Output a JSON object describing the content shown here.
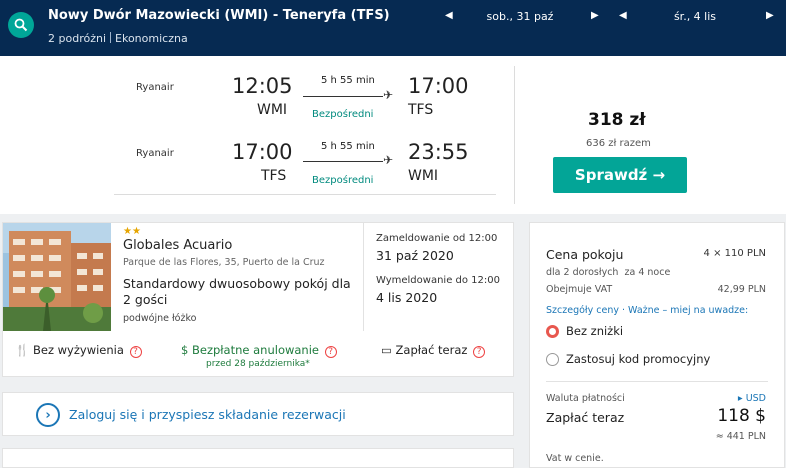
{
  "header": {
    "route": "Nowy Dwór Mazowiecki (WMI) - Teneryfa (TFS)",
    "passengers": "2 podróżni",
    "cabin": "Ekonomiczna",
    "depart_date": "sob., 31 paź",
    "return_date": "śr., 4 lis"
  },
  "flights": {
    "outbound": {
      "airline": "Ryanair",
      "dep_time": "12:05",
      "dep_code": "WMI",
      "duration": "5 h 55 min",
      "stops": "Bezpośredni",
      "arr_time": "17:00",
      "arr_code": "TFS"
    },
    "inbound": {
      "airline": "Ryanair",
      "dep_time": "17:00",
      "dep_code": "TFS",
      "duration": "5 h 55 min",
      "stops": "Bezpośredni",
      "arr_time": "23:55",
      "arr_code": "WMI"
    },
    "price": "318 zł",
    "total": "636 zł razem",
    "check_label": "Sprawdź →"
  },
  "hotel": {
    "stars": "★★",
    "name": "Globales Acuario",
    "address": "Parque de las Flores, 35, Puerto de la Cruz",
    "room": "Standardowy dwuosobowy pokój dla 2 gości",
    "bed": "podwójne łóżko",
    "checkin_label": "Zameldowanie od 12:00",
    "checkin_date": "31 paź 2020",
    "checkout_label": "Wymeldowanie do 12:00",
    "checkout_date": "4 lis 2020",
    "feature_meals": "Bez wyżywienia",
    "feature_cancel": "Bezpłatne anulowanie",
    "feature_cancel_sub": "przed 28 października*",
    "feature_pay": "Zapłać teraz"
  },
  "login": {
    "text": "Zaloguj się i przyspiesz składanie rezerwacji"
  },
  "sidebar": {
    "room_price_label": "Cena pokoju",
    "room_price_value": "4 × 110 PLN",
    "guests": "dla 2 dorosłych",
    "nights": "za 4 noce",
    "vat_label": "Obejmuje VAT",
    "vat_value": "42,99 PLN",
    "details_link": "Szczegóły ceny",
    "notice_link": "Ważne – miej na uwadze:",
    "option_no_discount": "Bez zniżki",
    "option_promo": "Zastosuj kod promocyjny",
    "currency_label": "Waluta płatności",
    "currency_value": "USD",
    "pay_now_label": "Zapłać teraz",
    "pay_now_value": "118 $",
    "pay_now_pln": "≈ 441 PLN",
    "vat_note": "Vat w cenie."
  },
  "colors": {
    "header_bg": "#062a52",
    "accent": "#03a597",
    "link": "#1b76b6",
    "radio_selected": "#e8574e"
  }
}
